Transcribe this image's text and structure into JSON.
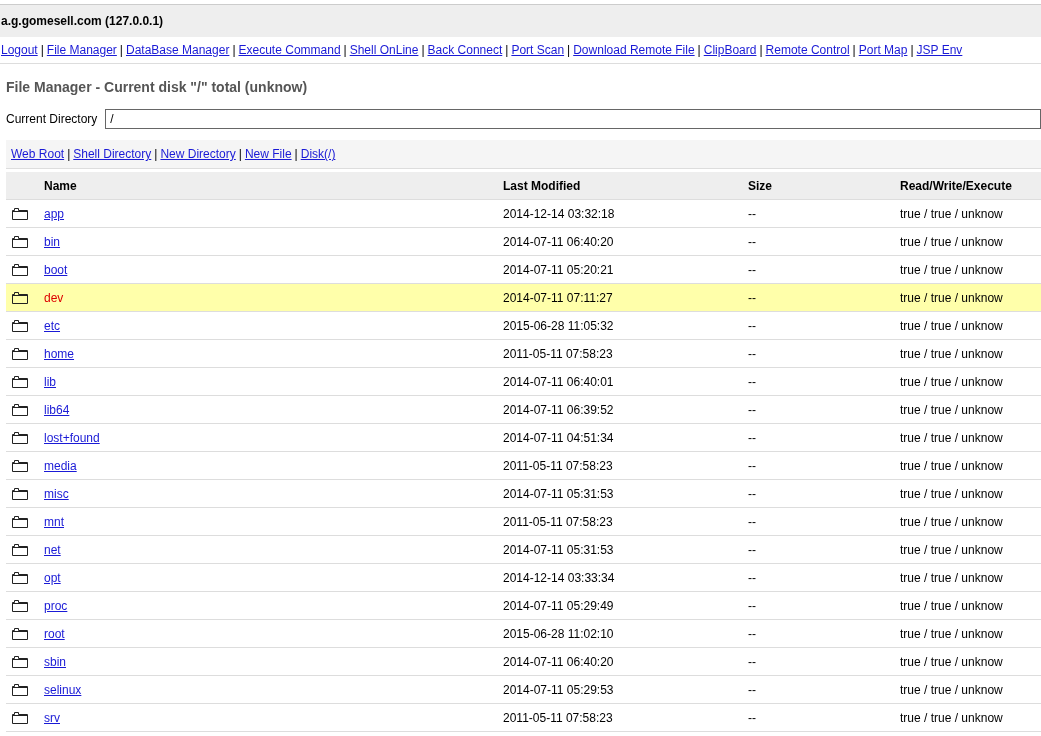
{
  "header": {
    "title": "a.g.gomesell.com (127.0.0.1)"
  },
  "nav": {
    "separator": "|",
    "links": [
      "Logout",
      "File Manager",
      "DataBase Manager",
      "Execute Command",
      "Shell OnLine",
      "Back Connect",
      "Port Scan",
      "Download Remote File",
      "ClipBoard",
      "Remote Control",
      "Port Map",
      "JSP Env"
    ]
  },
  "heading": "File Manager - Current disk \"/\" total (unknow)",
  "directory": {
    "label": "Current Directory",
    "value": "/"
  },
  "actions": {
    "separator": "|",
    "links": [
      "Web Root",
      "Shell Directory",
      "New Directory",
      "New File",
      "Disk(/)"
    ]
  },
  "table": {
    "columns": [
      "Name",
      "Last Modified",
      "Size",
      "Read/Write/Execute"
    ],
    "rows": [
      {
        "name": "app",
        "modified": "2014-12-14 03:32:18",
        "size": "--",
        "rwx": "true / true / unknow",
        "selected": false
      },
      {
        "name": "bin",
        "modified": "2014-07-11 06:40:20",
        "size": "--",
        "rwx": "true / true / unknow",
        "selected": false
      },
      {
        "name": "boot",
        "modified": "2014-07-11 05:20:21",
        "size": "--",
        "rwx": "true / true / unknow",
        "selected": false
      },
      {
        "name": "dev",
        "modified": "2014-07-11 07:11:27",
        "size": "--",
        "rwx": "true / true / unknow",
        "selected": true
      },
      {
        "name": "etc",
        "modified": "2015-06-28 11:05:32",
        "size": "--",
        "rwx": "true / true / unknow",
        "selected": false
      },
      {
        "name": "home",
        "modified": "2011-05-11 07:58:23",
        "size": "--",
        "rwx": "true / true / unknow",
        "selected": false
      },
      {
        "name": "lib",
        "modified": "2014-07-11 06:40:01",
        "size": "--",
        "rwx": "true / true / unknow",
        "selected": false
      },
      {
        "name": "lib64",
        "modified": "2014-07-11 06:39:52",
        "size": "--",
        "rwx": "true / true / unknow",
        "selected": false
      },
      {
        "name": "lost+found",
        "modified": "2014-07-11 04:51:34",
        "size": "--",
        "rwx": "true / true / unknow",
        "selected": false
      },
      {
        "name": "media",
        "modified": "2011-05-11 07:58:23",
        "size": "--",
        "rwx": "true / true / unknow",
        "selected": false
      },
      {
        "name": "misc",
        "modified": "2014-07-11 05:31:53",
        "size": "--",
        "rwx": "true / true / unknow",
        "selected": false
      },
      {
        "name": "mnt",
        "modified": "2011-05-11 07:58:23",
        "size": "--",
        "rwx": "true / true / unknow",
        "selected": false
      },
      {
        "name": "net",
        "modified": "2014-07-11 05:31:53",
        "size": "--",
        "rwx": "true / true / unknow",
        "selected": false
      },
      {
        "name": "opt",
        "modified": "2014-12-14 03:33:34",
        "size": "--",
        "rwx": "true / true / unknow",
        "selected": false
      },
      {
        "name": "proc",
        "modified": "2014-07-11 05:29:49",
        "size": "--",
        "rwx": "true / true / unknow",
        "selected": false
      },
      {
        "name": "root",
        "modified": "2015-06-28 11:02:10",
        "size": "--",
        "rwx": "true / true / unknow",
        "selected": false
      },
      {
        "name": "sbin",
        "modified": "2014-07-11 06:40:20",
        "size": "--",
        "rwx": "true / true / unknow",
        "selected": false
      },
      {
        "name": "selinux",
        "modified": "2014-07-11 05:29:53",
        "size": "--",
        "rwx": "true / true / unknow",
        "selected": false
      },
      {
        "name": "srv",
        "modified": "2011-05-11 07:58:23",
        "size": "--",
        "rwx": "true / true / unknow",
        "selected": false
      }
    ]
  }
}
